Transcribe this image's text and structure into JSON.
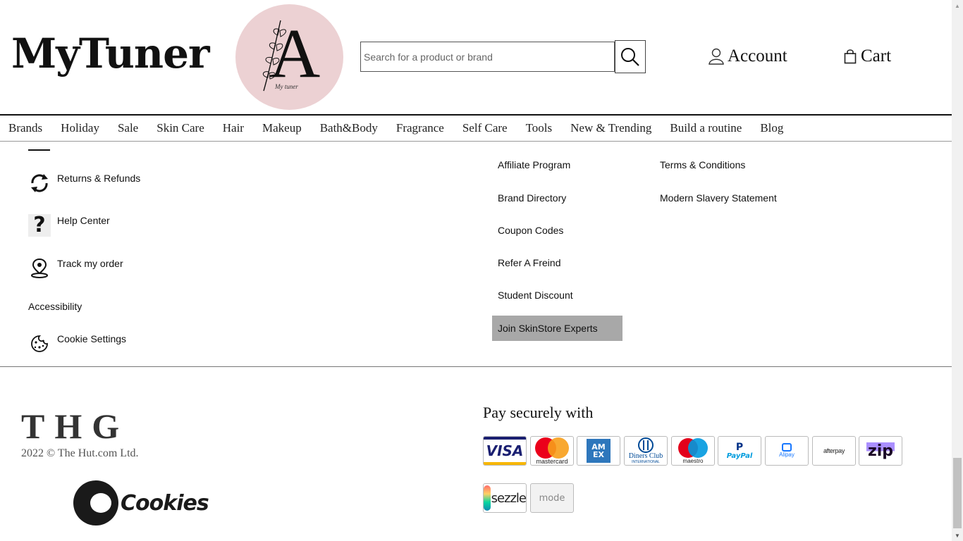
{
  "header": {
    "site_name": "MyTuner",
    "logo_letter": "A",
    "logo_subtext": "My tuner",
    "search_placeholder": "Search for a product or brand",
    "account_label": "Account",
    "cart_label": "Cart"
  },
  "nav": {
    "items": [
      "Brands",
      "Holiday",
      "Sale",
      "Skin Care",
      "Hair",
      "Makeup",
      "Bath&Body",
      "Fragrance",
      "Self Care",
      "Tools",
      "New & Trending",
      "Build a routine",
      "Blog"
    ]
  },
  "help": {
    "returns": "Returns & Refunds",
    "help_center": "Help Center",
    "track": "Track my order",
    "accessibility": "Accessibility",
    "cookie_settings": "Cookie Settings"
  },
  "links_col1": {
    "affiliate": "Affiliate Program",
    "brand_directory": "Brand Directory",
    "coupon_codes": "Coupon Codes",
    "refer": "Refer A Freind",
    "student": "Student Discount",
    "experts": "Join SkinStore Experts"
  },
  "links_col2": {
    "terms": "Terms & Conditions",
    "slavery": "Modern Slavery Statement"
  },
  "footer": {
    "thg": "THG",
    "copyright": "2022 © The Hut.com Ltd.",
    "cookies_word": "Cookies",
    "pay_title": "Pay securely with"
  },
  "payments": {
    "visa": "VISA",
    "mastercard": "mastercard",
    "amex": "AM EX",
    "diners_1": "Diners Club",
    "diners_2": "INTERNATIONAL",
    "maestro": "maestro",
    "paypal": "PayPal",
    "alipay": "Alipay",
    "afterpay": "afterpay",
    "zip": "zip",
    "sezzle": "sezzle",
    "mode": "mode"
  },
  "colors": {
    "logo_circle": "#ecd1d3",
    "experts_bg": "#a8a8a8",
    "visa_blue": "#1a1f71",
    "mastercard_red": "#eb001b",
    "mastercard_orange": "#f79e1b",
    "amex_blue": "#2e77bc",
    "paypal_blue": "#003087"
  }
}
